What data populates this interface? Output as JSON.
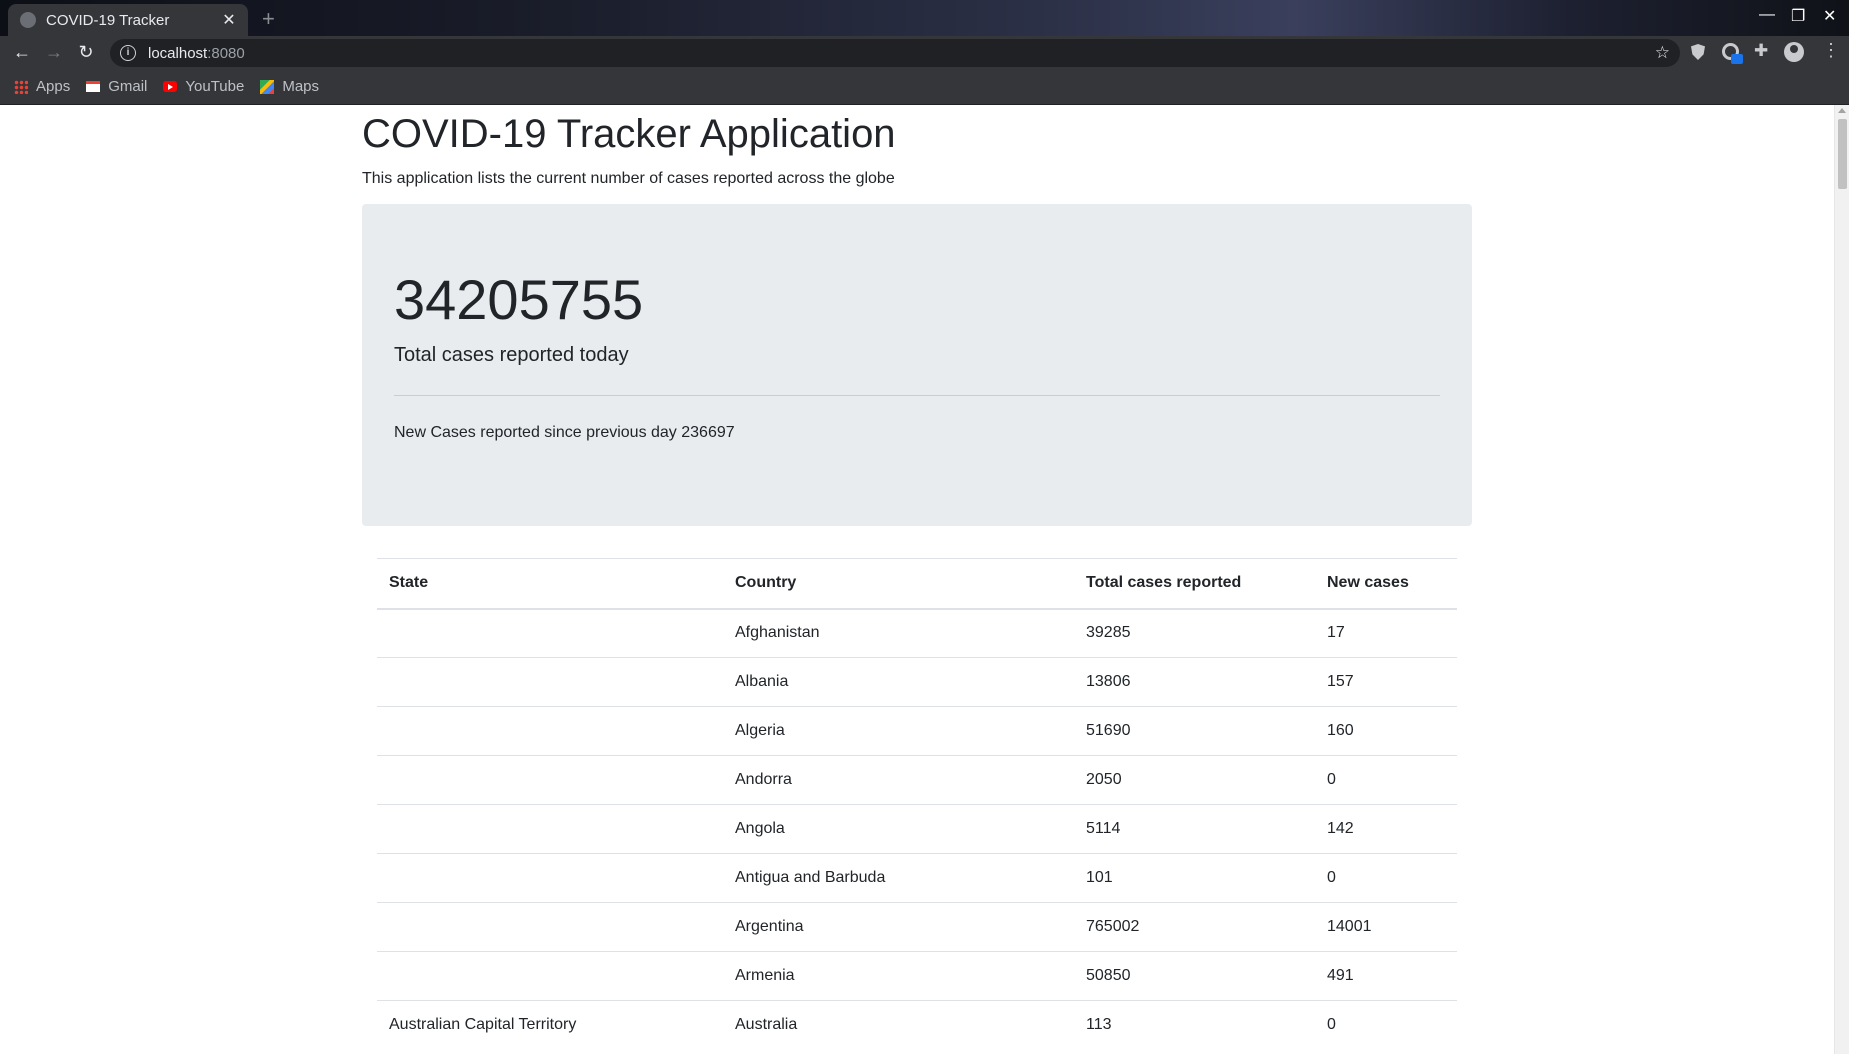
{
  "browser": {
    "tab_title": "COVID-19 Tracker",
    "url_host": "localhost",
    "url_port": ":8080",
    "bookmarks": [
      {
        "label": "Apps",
        "icon": "apps-grid-icon"
      },
      {
        "label": "Gmail",
        "icon": "gmail-icon"
      },
      {
        "label": "YouTube",
        "icon": "youtube-icon"
      },
      {
        "label": "Maps",
        "icon": "maps-icon"
      }
    ]
  },
  "page": {
    "title": "COVID-19 Tracker Application",
    "subtitle": "This application lists the current number of cases reported across the globe",
    "total_cases": "34205755",
    "total_caption": "Total cases reported today",
    "new_cases_text": "New Cases reported since previous day 236697"
  },
  "table": {
    "headers": [
      "State",
      "Country",
      "Total cases reported",
      "New cases"
    ],
    "rows": [
      [
        "",
        "Afghanistan",
        "39285",
        "17"
      ],
      [
        "",
        "Albania",
        "13806",
        "157"
      ],
      [
        "",
        "Algeria",
        "51690",
        "160"
      ],
      [
        "",
        "Andorra",
        "2050",
        "0"
      ],
      [
        "",
        "Angola",
        "5114",
        "142"
      ],
      [
        "",
        "Antigua and Barbuda",
        "101",
        "0"
      ],
      [
        "",
        "Argentina",
        "765002",
        "14001"
      ],
      [
        "",
        "Armenia",
        "50850",
        "491"
      ],
      [
        "Australian Capital Territory",
        "Australia",
        "113",
        "0"
      ]
    ]
  },
  "colors": {
    "jumbotron_bg": "#e9ecef",
    "text": "#212529",
    "chrome_bg": "#35363a"
  }
}
